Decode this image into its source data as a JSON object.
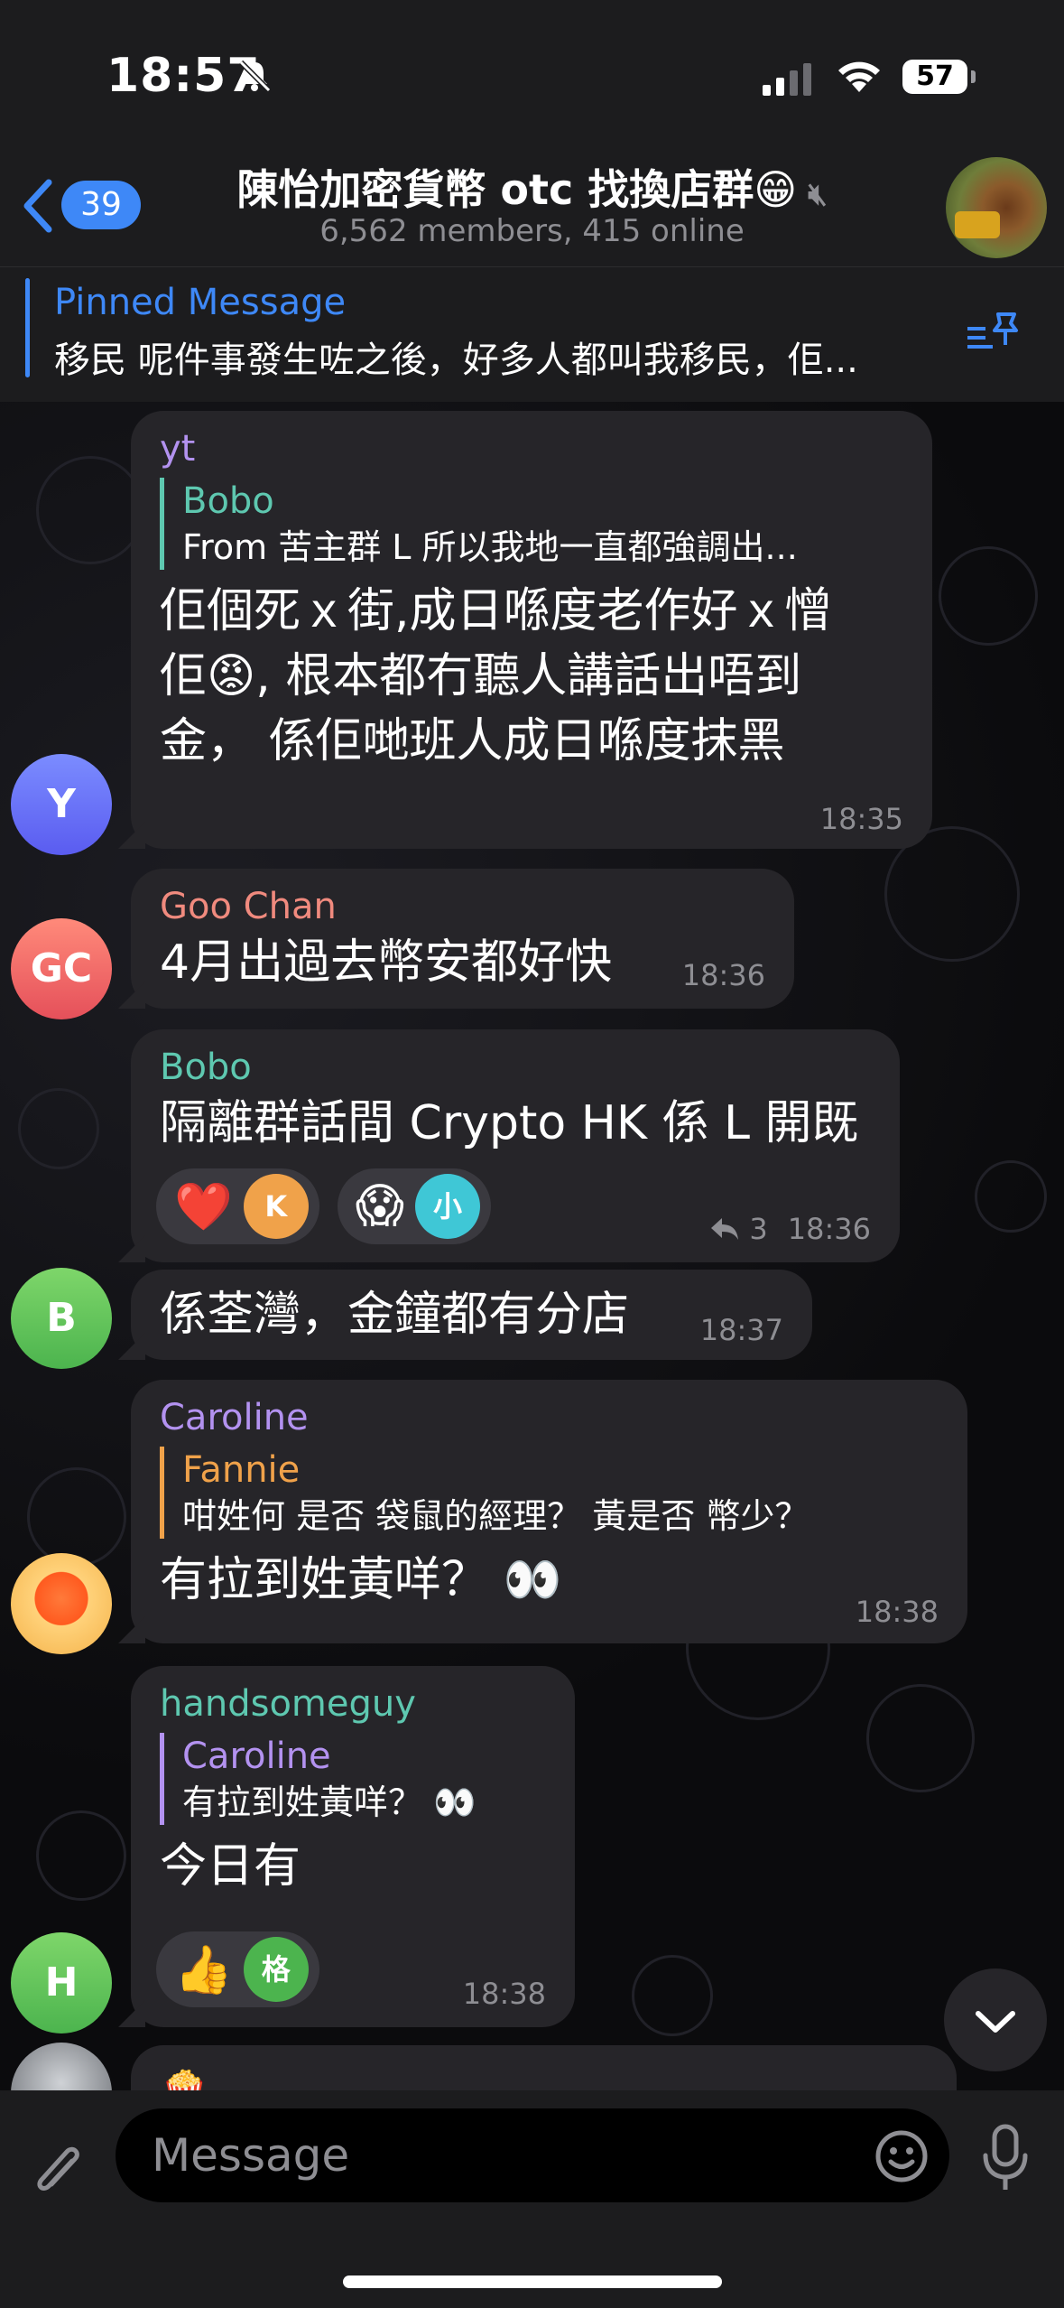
{
  "status": {
    "time": "18:57",
    "battery": "57"
  },
  "header": {
    "back_count": "39",
    "title": "陳怡加密貨幣 otc 找換店群😁",
    "subtitle": "6,562 members, 415 online"
  },
  "pinned": {
    "title": "Pinned Message",
    "text": "移民 呢件事發生咗之後，好多人都叫我移民，佢..."
  },
  "messages": [
    {
      "sender": "yt",
      "sender_color": "#b392f0",
      "avatar": "Y",
      "reply": {
        "name": "Bobo",
        "text": "From 苦主群 L 所以我地一直都強調出..."
      },
      "lines": [
        "佢個死ｘ街,成日喺度老作好ｘ憎",
        "佢😡, 根本都冇聽人講話出唔到",
        "金，  係佢哋班人成日喺度抹黑"
      ],
      "time": "18:35"
    },
    {
      "sender": "Goo Chan",
      "sender_color": "#f08a7e",
      "avatar": "GC",
      "text": "4月出過去幣安都好快",
      "time": "18:36"
    },
    {
      "sender": "Bobo",
      "sender_color": "#5ec8b0",
      "text": "隔離群話間 Crypto HK 係 L 開既",
      "reactions": [
        {
          "emoji": "❤️",
          "user": "K"
        },
        {
          "emoji": "😱",
          "user": "小"
        }
      ],
      "replies": "3",
      "time": "18:36"
    },
    {
      "avatar": "B",
      "text": "係荃灣，金鐘都有分店",
      "time": "18:37"
    },
    {
      "sender": "Caroline",
      "sender_color": "#b392f0",
      "reply": {
        "name": "Fannie",
        "text": "咁姓何 是否 袋鼠的經理？  黃是否 幣少？"
      },
      "text": "有拉到姓黃咩？ 👀",
      "time": "18:38"
    },
    {
      "sender": "handsomeguy",
      "sender_color": "#5ec8b0",
      "avatar": "H",
      "reply": {
        "name": "Caroline",
        "text": "有拉到姓黃咩？ 👀"
      },
      "text": "今日有",
      "reactions": [
        {
          "emoji": "👍",
          "user": "格"
        }
      ],
      "time": "18:38"
    },
    {
      "text": "🍿"
    }
  ],
  "input": {
    "placeholder": "Message"
  },
  "colors": {
    "accent": "#3e88f7",
    "bubble": "#262529",
    "bar": "#1c1c1e"
  }
}
